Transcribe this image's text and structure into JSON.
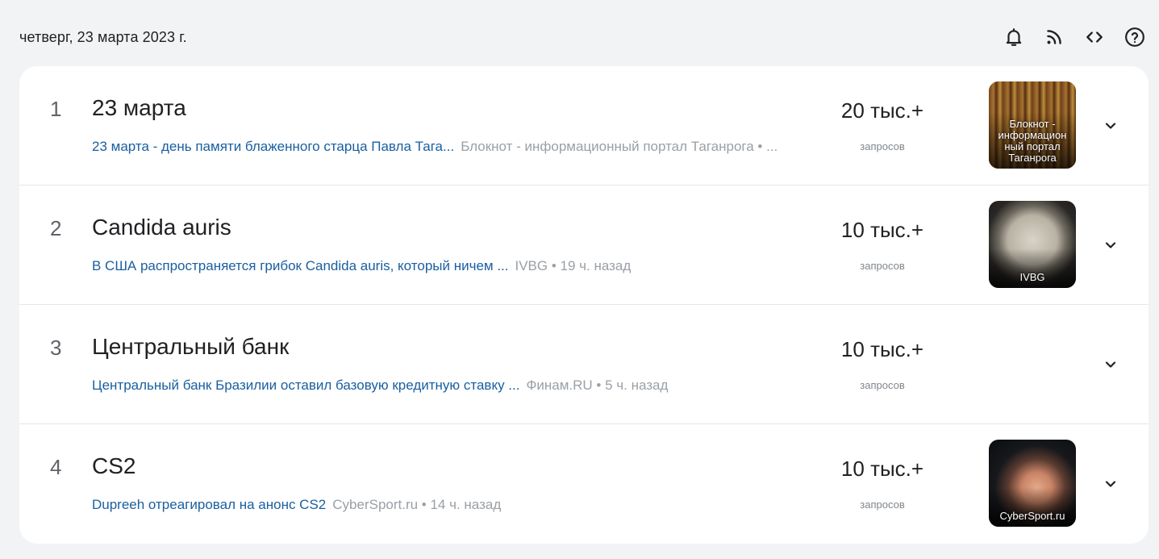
{
  "header": {
    "date": "четверг, 23 марта 2023 г.",
    "icons": [
      "bell-icon",
      "rss-icon",
      "code-icon",
      "help-icon"
    ]
  },
  "trends": [
    {
      "rank": "1",
      "title": "23 марта",
      "article": "23 марта - день памяти блаженного старца Павла Тага...",
      "source": "Блокнот - информационный портал Таганрога • ...",
      "volume": "20 тыс.+",
      "volume_label": "запросов",
      "thumb_caption": "Блокнот - информацион ный портал Таганрога"
    },
    {
      "rank": "2",
      "title": "Candida auris",
      "article": "В США распространяется грибок Candida auris, который ничем ...",
      "source": "IVBG • 19 ч. назад",
      "volume": "10 тыс.+",
      "volume_label": "запросов",
      "thumb_caption": "IVBG"
    },
    {
      "rank": "3",
      "title": "Центральный банк",
      "article": "Центральный банк Бразилии оставил базовую кредитную ставку ...",
      "source": "Финам.RU • 5 ч. назад",
      "volume": "10 тыс.+",
      "volume_label": "запросов"
    },
    {
      "rank": "4",
      "title": "CS2",
      "article": "Dupreeh отреагировал на анонс CS2",
      "source": "CyberSport.ru • 14 ч. назад",
      "volume": "10 тыс.+",
      "volume_label": "запросов",
      "thumb_caption": "CyberSport.ru"
    }
  ],
  "colors": {
    "background": "#f1f3f4",
    "card": "#ffffff",
    "link": "#1a5fa0",
    "muted": "#9aa0a6"
  }
}
